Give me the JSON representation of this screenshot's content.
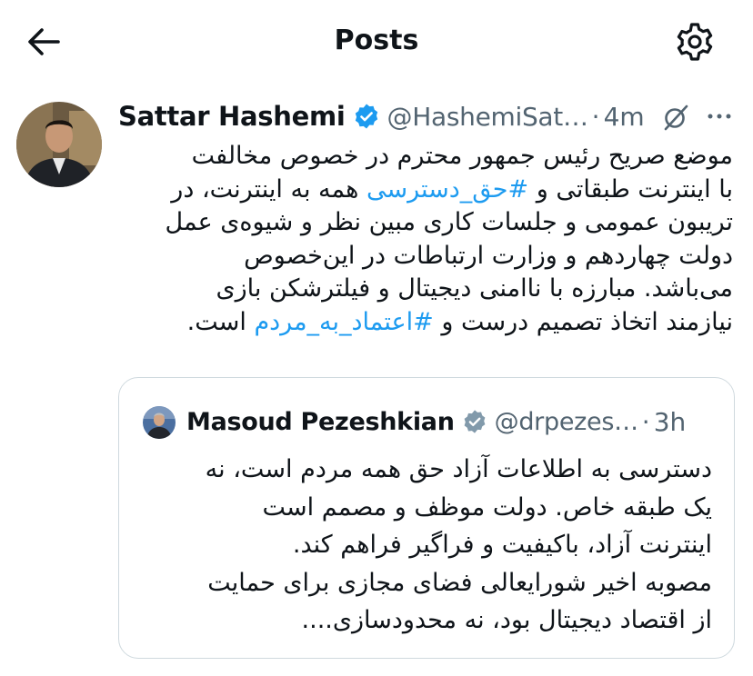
{
  "header": {
    "title": "Posts",
    "back_icon": "arrow-left-icon",
    "settings_icon": "gear-icon"
  },
  "post": {
    "author_name": "Sattar Hashemi",
    "handle": "@HashemiSat…",
    "separator": "·",
    "time": "4m",
    "text_lines": [
      "موضع صریح رئیس جمهور محترم در خصوص مخالفت",
      [
        "با اینترنت طبقاتی و ",
        "#حق_دسترسی",
        " همه به اینترنت، در"
      ],
      "تریبون عمومی و جلسات کاری مبین نظر و شیوه‌ی عمل",
      "دولت چهاردهم و وزارت ارتباطات در این‌خصوص",
      "می‌باشد. مبارزه با ناامنی دیجیتال و فیلترشکن بازی",
      [
        "نیازمند اتخاذ تصمیم درست و ",
        "#اعتماد_به_مردم",
        " است."
      ]
    ],
    "line1": "موضع صریح رئیس جمهور محترم در خصوص مخالفت",
    "line2_a": "با اینترنت طبقاتی و ",
    "line2_tag": "#حق_دسترسی",
    "line2_b": " همه به اینترنت، در",
    "line3": "تریبون عمومی و جلسات کاری مبین نظر و شیوه‌ی عمل",
    "line4": "دولت چهاردهم و وزارت ارتباطات در این‌خصوص",
    "line5": "می‌باشد. مبارزه با ناامنی دیجیتال و فیلترشکن بازی",
    "line6_a": "نیازمند اتخاذ تصمیم درست و ",
    "line6_tag": "#اعتماد_به_مردم",
    "line6_b": " است.",
    "icons": [
      "verified-badge-icon",
      "grok-icon",
      "more-icon"
    ]
  },
  "quote": {
    "author_name": "Masoud Pezeshkian",
    "handle": "@drpezes…",
    "separator": "·",
    "time": "3h",
    "line1": "دسترسی به اطلاعات آزاد حق همه مردم است، نه",
    "line2": "یک طبقه خاص. دولت موظف و مصمم است",
    "line3": "اینترنت آزاد، باکیفیت و فراگیر فراهم کند.",
    "line4": "مصوبه اخیر شورایعالی فضای مجازی برای حمایت",
    "line5": "از اقتصاد دیجیتال بود، نه محدودسازی...."
  },
  "colors": {
    "link": "#1d9bf0",
    "verified": "#1d9bf0",
    "secondary_text": "#536471",
    "border": "#cfd9de"
  }
}
